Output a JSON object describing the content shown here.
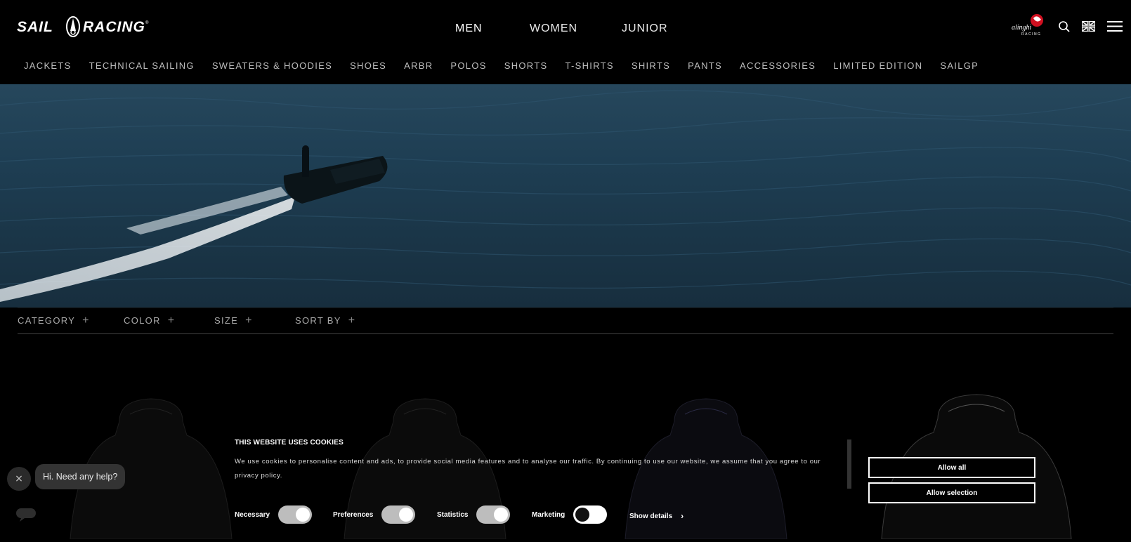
{
  "brand": {
    "logo_text": "SAIL RACING",
    "partner_logo": "alinghi RACING"
  },
  "main_nav": [
    "MEN",
    "WOMEN",
    "JUNIOR"
  ],
  "header_icons": [
    "search-icon",
    "flag-icon",
    "menu-icon"
  ],
  "sub_nav": [
    "JACKETS",
    "TECHNICAL SAILING",
    "SWEATERS & HOODIES",
    "SHOES",
    "ARBR",
    "POLOS",
    "SHORTS",
    "T-SHIRTS",
    "SHIRTS",
    "PANTS",
    "ACCESSORIES",
    "LIMITED EDITION",
    "SAILGP"
  ],
  "filters": [
    {
      "label": "CATEGORY"
    },
    {
      "label": "COLOR"
    },
    {
      "label": "SIZE"
    },
    {
      "label": "SORT BY"
    }
  ],
  "cookie": {
    "title": "THIS WEBSITE USES COOKIES",
    "text": "We use cookies to personalise content and ads, to provide social media features and to analyse our traffic. By continuing to use our website, we assume that you agree to our privacy policy.",
    "toggles": [
      {
        "label": "Necessary",
        "on": true
      },
      {
        "label": "Preferences",
        "on": true
      },
      {
        "label": "Statistics",
        "on": true
      },
      {
        "label": "Marketing",
        "on": false
      }
    ],
    "show_details": "Show details",
    "allow_all": "Allow all",
    "allow_selection": "Allow selection"
  },
  "chat": {
    "close": "×",
    "message": "Hi. Need any help?"
  },
  "colors": {
    "background": "#000000",
    "text": "#ffffff",
    "sea": "#1e3e53"
  }
}
